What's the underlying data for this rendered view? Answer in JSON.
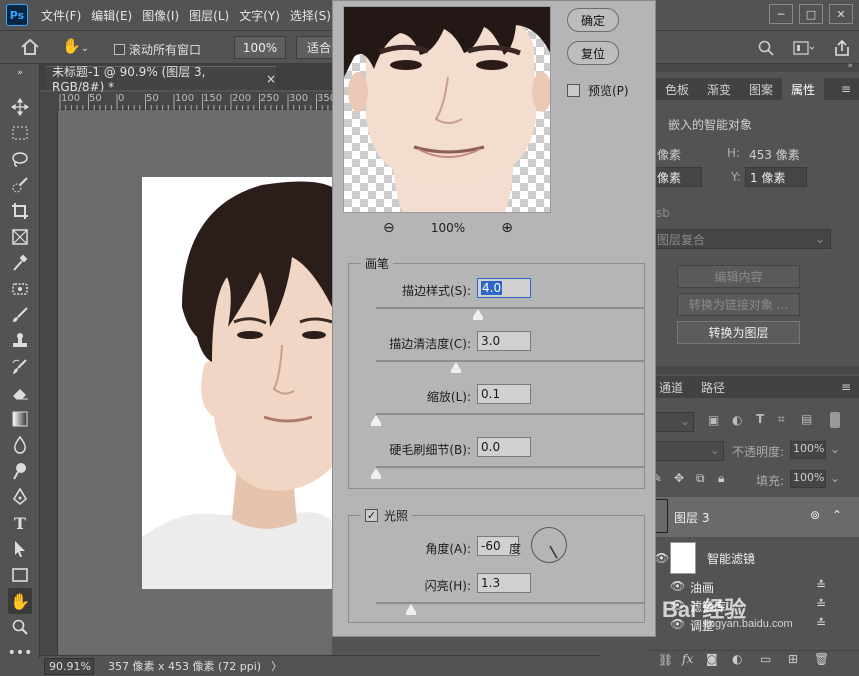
{
  "app": {
    "logo": "Ps"
  },
  "menu": [
    "文件(F)",
    "编辑(E)",
    "图像(I)",
    "图层(L)",
    "文字(Y)",
    "选择(S)"
  ],
  "window_buttons": {
    "minimize": "─",
    "maximize": "□",
    "close": "✕"
  },
  "options_bar": {
    "scroll_all_windows": "滚动所有窗口",
    "zoom_100": "100%",
    "fit_screen": "适合"
  },
  "document_tab": {
    "title": "未标题-1 @ 90.9% (图层 3, RGB/8#) *",
    "close": "×"
  },
  "ruler_top_labels": [
    "100",
    "50",
    "0",
    "50",
    "100",
    "150",
    "200",
    "250",
    "300",
    "350"
  ],
  "status_bar": {
    "zoom": "90.91%",
    "doc_info": "357 像素 x 453 像素 (72 ppi)",
    "arrow": "〉"
  },
  "properties": {
    "tabs": [
      "色板",
      "渐变",
      "图案",
      "属性"
    ],
    "active_tab": "属性",
    "kind": "嵌入的智能对象",
    "w_value": "像素",
    "h_label": "H:",
    "h_value": "453 像素",
    "x_value": "像素",
    "y_label": "Y:",
    "y_value": "1 像素",
    "source_label": "sb",
    "layer_comp": "图层复合",
    "buttons": {
      "edit_contents": "编辑内容",
      "convert_linked": "转换为链接对象 ...",
      "convert_layers": "转换为图层"
    }
  },
  "layers": {
    "tabs": [
      "通道",
      "路径"
    ],
    "opacity_label": "不透明度:",
    "opacity_value": "100%",
    "fill_label": "填充:",
    "fill_value": "100%",
    "layer_name": "图层 3",
    "smart_filters_label": "智能滤镜",
    "filter_items": [
      "油画",
      "滤镜库",
      "调整"
    ]
  },
  "dialog": {
    "ok": "确定",
    "reset": "复位",
    "preview": "预览(P)",
    "preview_zoom": "100%",
    "brush_group": "画笔",
    "stylization_label": "描边样式(S):",
    "stylization_value": "4.0",
    "stylization_level": 0.38,
    "cleanliness_label": "描边清洁度(C):",
    "cleanliness_value": "3.0",
    "cleanliness_level": 0.3,
    "scale_label": "缩放(L):",
    "scale_value": "0.1",
    "scale_level": 0.0,
    "bristle_label": "硬毛刷细节(B):",
    "bristle_value": "0.0",
    "bristle_level": 0.0,
    "lighting_group": "光照",
    "lighting_checked": true,
    "angle_label": "角度(A):",
    "angle_value": "-60",
    "angle_unit": "度",
    "shine_label": "闪亮(H):",
    "shine_value": "1.3",
    "shine_level": 0.13
  },
  "watermark": {
    "brand": "Bai 经验",
    "url": "jingyan.baidu.com"
  }
}
